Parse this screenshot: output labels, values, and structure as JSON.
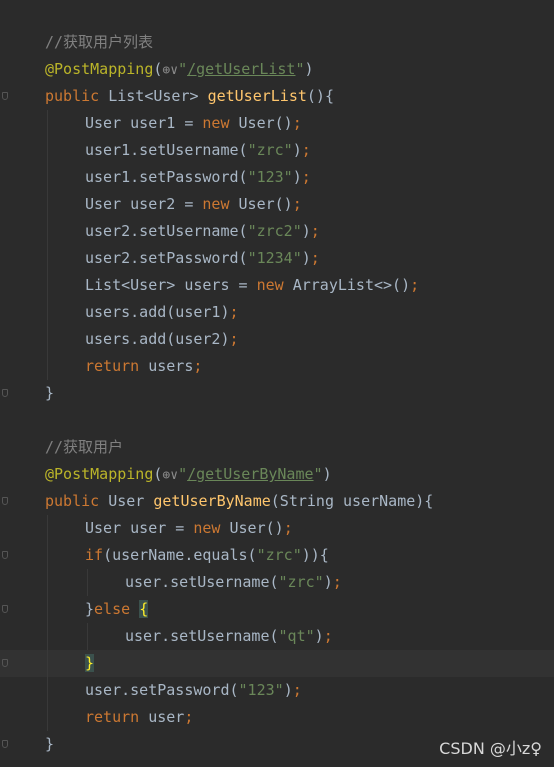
{
  "editor": {
    "lines": [
      {
        "indent": 0,
        "tokens": [
          [
            "cmt",
            "//获取用户列表"
          ]
        ]
      },
      {
        "indent": 0,
        "tokens": [
          [
            "ann",
            "@PostMapping"
          ],
          [
            "plain",
            "("
          ],
          [
            "gicon",
            "⊕∨"
          ],
          [
            "str",
            "\""
          ],
          [
            "link",
            "/getUserList"
          ],
          [
            "str",
            "\""
          ],
          [
            "plain",
            ")"
          ]
        ]
      },
      {
        "indent": 0,
        "fold": true,
        "tokens": [
          [
            "kw",
            "public "
          ],
          [
            "plain",
            "List<User> "
          ],
          [
            "fn",
            "getUserList"
          ],
          [
            "plain",
            "(){"
          ]
        ]
      },
      {
        "indent": 1,
        "tokens": [
          [
            "plain",
            "User user1 = "
          ],
          [
            "kw",
            "new "
          ],
          [
            "plain",
            "User()"
          ],
          [
            "kw",
            ";"
          ]
        ]
      },
      {
        "indent": 1,
        "tokens": [
          [
            "plain",
            "user1.setUsername("
          ],
          [
            "str",
            "\"zrc\""
          ],
          [
            "plain",
            ")"
          ],
          [
            "kw",
            ";"
          ]
        ]
      },
      {
        "indent": 1,
        "tokens": [
          [
            "plain",
            "user1.setPassword("
          ],
          [
            "str",
            "\"123\""
          ],
          [
            "plain",
            ")"
          ],
          [
            "kw",
            ";"
          ]
        ]
      },
      {
        "indent": 1,
        "tokens": [
          [
            "plain",
            "User user2 = "
          ],
          [
            "kw",
            "new "
          ],
          [
            "plain",
            "User()"
          ],
          [
            "kw",
            ";"
          ]
        ]
      },
      {
        "indent": 1,
        "tokens": [
          [
            "plain",
            "user2.setUsername("
          ],
          [
            "str",
            "\"zrc2\""
          ],
          [
            "plain",
            ")"
          ],
          [
            "kw",
            ";"
          ]
        ]
      },
      {
        "indent": 1,
        "tokens": [
          [
            "plain",
            "user2.setPassword("
          ],
          [
            "str",
            "\"1234\""
          ],
          [
            "plain",
            ")"
          ],
          [
            "kw",
            ";"
          ]
        ]
      },
      {
        "indent": 1,
        "tokens": [
          [
            "plain",
            "List<User> users = "
          ],
          [
            "kw",
            "new "
          ],
          [
            "plain",
            "ArrayList<>()"
          ],
          [
            "kw",
            ";"
          ]
        ]
      },
      {
        "indent": 1,
        "tokens": [
          [
            "plain",
            "users.add(user1)"
          ],
          [
            "kw",
            ";"
          ]
        ]
      },
      {
        "indent": 1,
        "tokens": [
          [
            "plain",
            "users.add(user2)"
          ],
          [
            "kw",
            ";"
          ]
        ]
      },
      {
        "indent": 1,
        "tokens": [
          [
            "kw",
            "return "
          ],
          [
            "plain",
            "users"
          ],
          [
            "kw",
            ";"
          ]
        ]
      },
      {
        "indent": 0,
        "fold": true,
        "tokens": [
          [
            "plain",
            "}"
          ]
        ]
      },
      {
        "indent": 0,
        "tokens": []
      },
      {
        "indent": 0,
        "tokens": [
          [
            "cmt",
            "//获取用户"
          ]
        ]
      },
      {
        "indent": 0,
        "tokens": [
          [
            "ann",
            "@PostMapping"
          ],
          [
            "plain",
            "("
          ],
          [
            "gicon",
            "⊕∨"
          ],
          [
            "str",
            "\""
          ],
          [
            "link",
            "/getUserByName"
          ],
          [
            "str",
            "\""
          ],
          [
            "plain",
            ")"
          ]
        ]
      },
      {
        "indent": 0,
        "fold": true,
        "tokens": [
          [
            "kw",
            "public "
          ],
          [
            "plain",
            "User "
          ],
          [
            "fn",
            "getUserByName"
          ],
          [
            "plain",
            "(String userName){"
          ]
        ]
      },
      {
        "indent": 1,
        "tokens": [
          [
            "plain",
            "User user = "
          ],
          [
            "kw",
            "new "
          ],
          [
            "plain",
            "User()"
          ],
          [
            "kw",
            ";"
          ]
        ]
      },
      {
        "indent": 1,
        "fold": true,
        "tokens": [
          [
            "kw",
            "if"
          ],
          [
            "plain",
            "(userName.equals("
          ],
          [
            "str",
            "\"zrc\""
          ],
          [
            "plain",
            ")){"
          ]
        ]
      },
      {
        "indent": 2,
        "tokens": [
          [
            "plain",
            "user.setUsername("
          ],
          [
            "str",
            "\"zrc\""
          ],
          [
            "plain",
            ")"
          ],
          [
            "kw",
            ";"
          ]
        ]
      },
      {
        "indent": 1,
        "fold": true,
        "tokens": [
          [
            "plain",
            "}"
          ],
          [
            "kw",
            "else "
          ],
          [
            "brace-hl",
            "{"
          ]
        ]
      },
      {
        "indent": 2,
        "tokens": [
          [
            "plain",
            "user.setUsername("
          ],
          [
            "str",
            "\"qt\""
          ],
          [
            "plain",
            ")"
          ],
          [
            "kw",
            ";"
          ]
        ]
      },
      {
        "indent": 1,
        "current": true,
        "fold": true,
        "tokens": [
          [
            "brace-hl",
            "}"
          ]
        ]
      },
      {
        "indent": 1,
        "tokens": [
          [
            "plain",
            "user.setPassword("
          ],
          [
            "str",
            "\"123\""
          ],
          [
            "plain",
            ")"
          ],
          [
            "kw",
            ";"
          ]
        ]
      },
      {
        "indent": 1,
        "tokens": [
          [
            "kw",
            "return "
          ],
          [
            "plain",
            "user"
          ],
          [
            "kw",
            ";"
          ]
        ]
      },
      {
        "indent": 0,
        "fold": true,
        "tokens": [
          [
            "plain",
            "}"
          ]
        ]
      }
    ]
  },
  "watermark": "CSDN @小z♀"
}
